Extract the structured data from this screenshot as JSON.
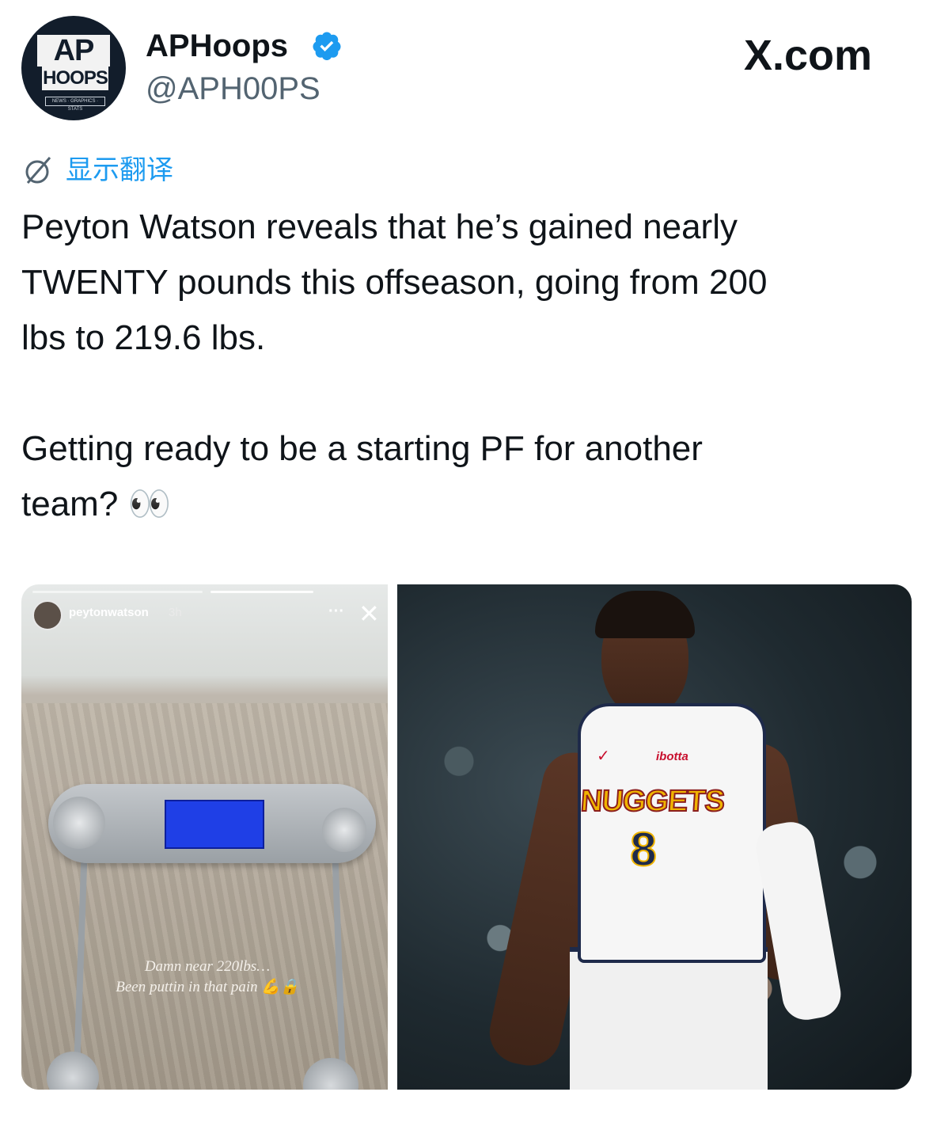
{
  "header": {
    "avatar": {
      "line1": "AP",
      "line2": "HOOPS",
      "line3": "NEWS · GRAPHICS · STATS"
    },
    "display_name": "APHoops",
    "handle": "@APH00PS",
    "site": "X.com"
  },
  "translate": {
    "label": "显示翻译",
    "icon": "translate-globe-icon"
  },
  "tweet": {
    "text": "Peyton Watson reveals that he’s gained nearly\nTWENTY pounds this offseason, going from 200\nlbs to 219.6 lbs.\n\nGetting ready to be a starting PF for another\nteam? 👀"
  },
  "media": {
    "left": {
      "story_user": "peytonwatson",
      "story_time": "3h",
      "menu": "···",
      "close": "✕",
      "caption_line1": "Damn near 220lbs…",
      "caption_line2": "Been puttin in that pain 💪🔒"
    },
    "right": {
      "sponsor": "ibotta",
      "team": "NUGGETS",
      "number": "8",
      "swoosh": "✓"
    }
  },
  "colors": {
    "verified": "#1d9bf0",
    "link": "#1d9bf0",
    "text": "#0f1419",
    "secondary": "#536471"
  }
}
